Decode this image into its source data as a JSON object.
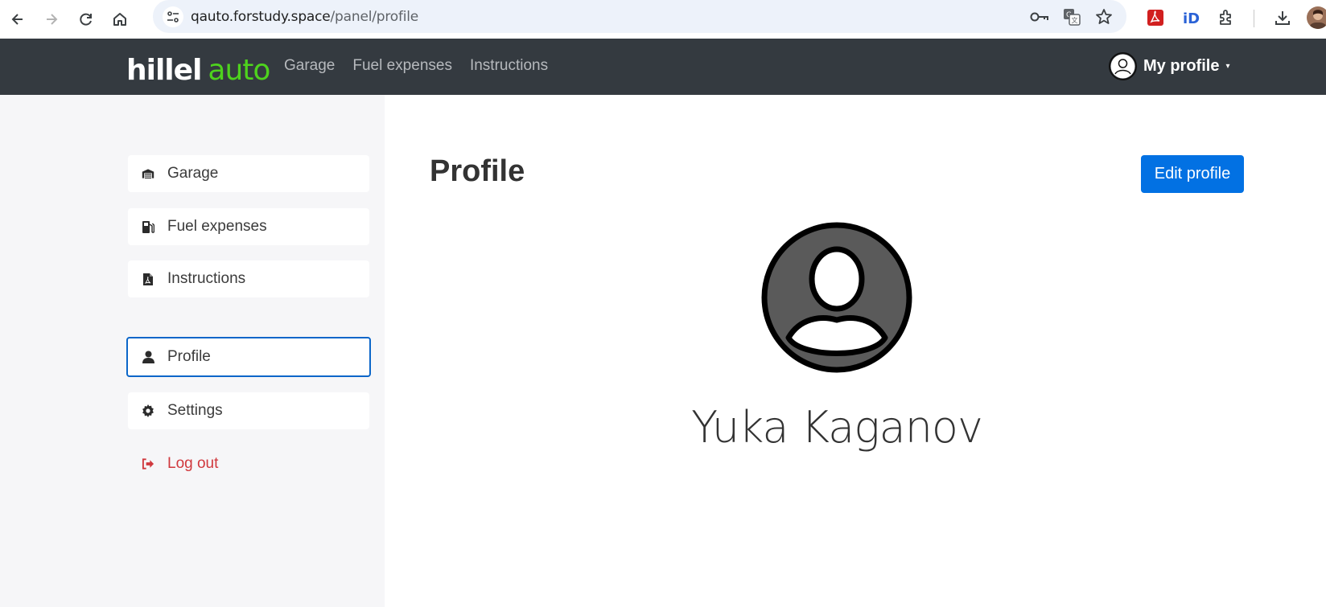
{
  "browser": {
    "url_host": "qauto.forstudy.space",
    "url_path": "/panel/profile",
    "icons": [
      "back-icon",
      "forward-icon",
      "reload-icon",
      "home-icon",
      "site-settings-icon",
      "password-key-icon",
      "translate-icon",
      "bookmark-star-icon",
      "pdf-extension-icon",
      "id-extension-icon",
      "extensions-puzzle-icon",
      "download-icon",
      "user-avatar-icon"
    ]
  },
  "header": {
    "logo_part1": "hillel",
    "logo_part2": "auto",
    "nav": {
      "garage": "Garage",
      "fuel": "Fuel expenses",
      "instructions": "Instructions"
    },
    "profile_label": "My profile",
    "profile_caret": "▾"
  },
  "sidebar": {
    "items": [
      {
        "label": "Garage",
        "icon": "garage-icon"
      },
      {
        "label": "Fuel expenses",
        "icon": "fuel-pump-icon"
      },
      {
        "label": "Instructions",
        "icon": "pdf-file-icon"
      },
      {
        "label": "Profile",
        "icon": "user-icon"
      },
      {
        "label": "Settings",
        "icon": "gear-icon"
      },
      {
        "label": "Log out",
        "icon": "logout-icon"
      }
    ]
  },
  "main": {
    "title": "Profile",
    "edit_button": "Edit profile",
    "user_name": "Yuka Kaganov"
  },
  "colors": {
    "header_bg": "#343a40",
    "brand_green": "#4ed31d",
    "primary_blue": "#0271e3",
    "active_border": "#0b66c9",
    "logout_red": "#d0383d",
    "sidebar_bg": "#f6f6f8"
  }
}
